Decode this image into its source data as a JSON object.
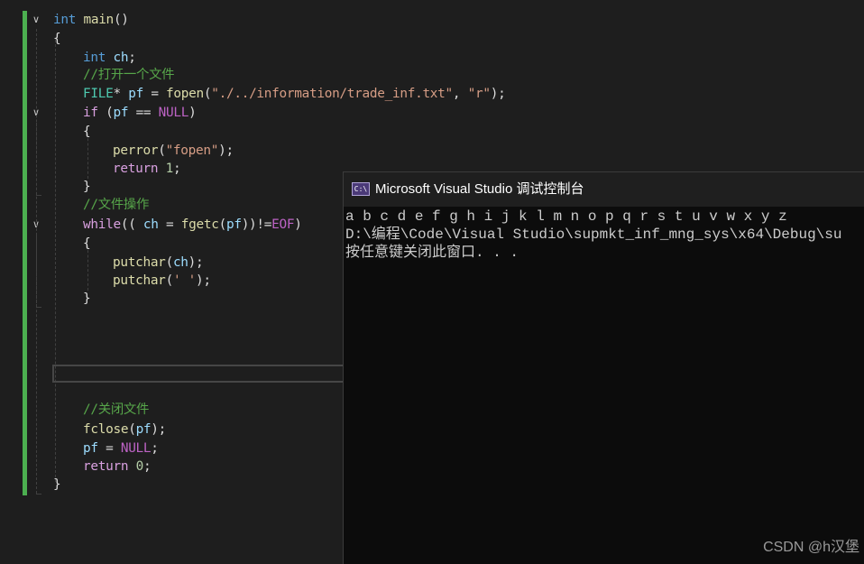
{
  "editor": {
    "code": {
      "l1": {
        "kw": "int",
        "fn": "main",
        "paren": "()"
      },
      "l2": "{",
      "l3": {
        "kw": "int",
        "var": "ch",
        "semi": ";"
      },
      "l4": "//打开一个文件",
      "l5": {
        "type": "FILE",
        "star": "*",
        "var": "pf",
        "eq": " = ",
        "fn": "fopen",
        "open": "(",
        "str1": "\"./../information/trade_inf.txt\"",
        "comma": ", ",
        "str2": "\"r\"",
        "close": ");"
      },
      "l6": {
        "kw": "if",
        "open": " (",
        "var": "pf",
        "op": " == ",
        "macro": "NULL",
        "close": ")"
      },
      "l7": "{",
      "l8": {
        "fn": "perror",
        "open": "(",
        "str": "\"fopen\"",
        "close": ");"
      },
      "l9": {
        "kw": "return",
        "num": "1",
        "semi": ";"
      },
      "l10": "}",
      "l11": "//文件操作",
      "l12": {
        "kw": "while",
        "p1": "(( ",
        "var1": "ch",
        "eq": " = ",
        "fn": "fgetc",
        "p2": "(",
        "var2": "pf",
        "p3": "))!=",
        "macro": "EOF",
        "p4": ")"
      },
      "l13": "{",
      "l14": {
        "fn": "putchar",
        "open": "(",
        "var": "ch",
        "close": ");"
      },
      "l15": {
        "fn": "putchar",
        "open": "(",
        "str": "' '",
        "close": ");"
      },
      "l16": "}",
      "l17": "//关闭文件",
      "l18": {
        "fn": "fclose",
        "open": "(",
        "var": "pf",
        "close": ");"
      },
      "l19": {
        "var": "pf",
        "eq": " = ",
        "macro": "NULL",
        "semi": ";"
      },
      "l20": {
        "kw": "return",
        "num": "0",
        "semi": ";"
      },
      "l21": "}"
    },
    "fold_glyph": "∨"
  },
  "console": {
    "icon_text": "C:\\",
    "title": "Microsoft Visual Studio 调试控制台",
    "output": [
      "a b c d e f g h i j k l m n o p q r s t u v w x y z",
      "D:\\编程\\Code\\Visual Studio\\supmkt_inf_mng_sys\\x64\\Debug\\su",
      "按任意键关闭此窗口. . ."
    ]
  },
  "watermark": "CSDN @h汉堡"
}
